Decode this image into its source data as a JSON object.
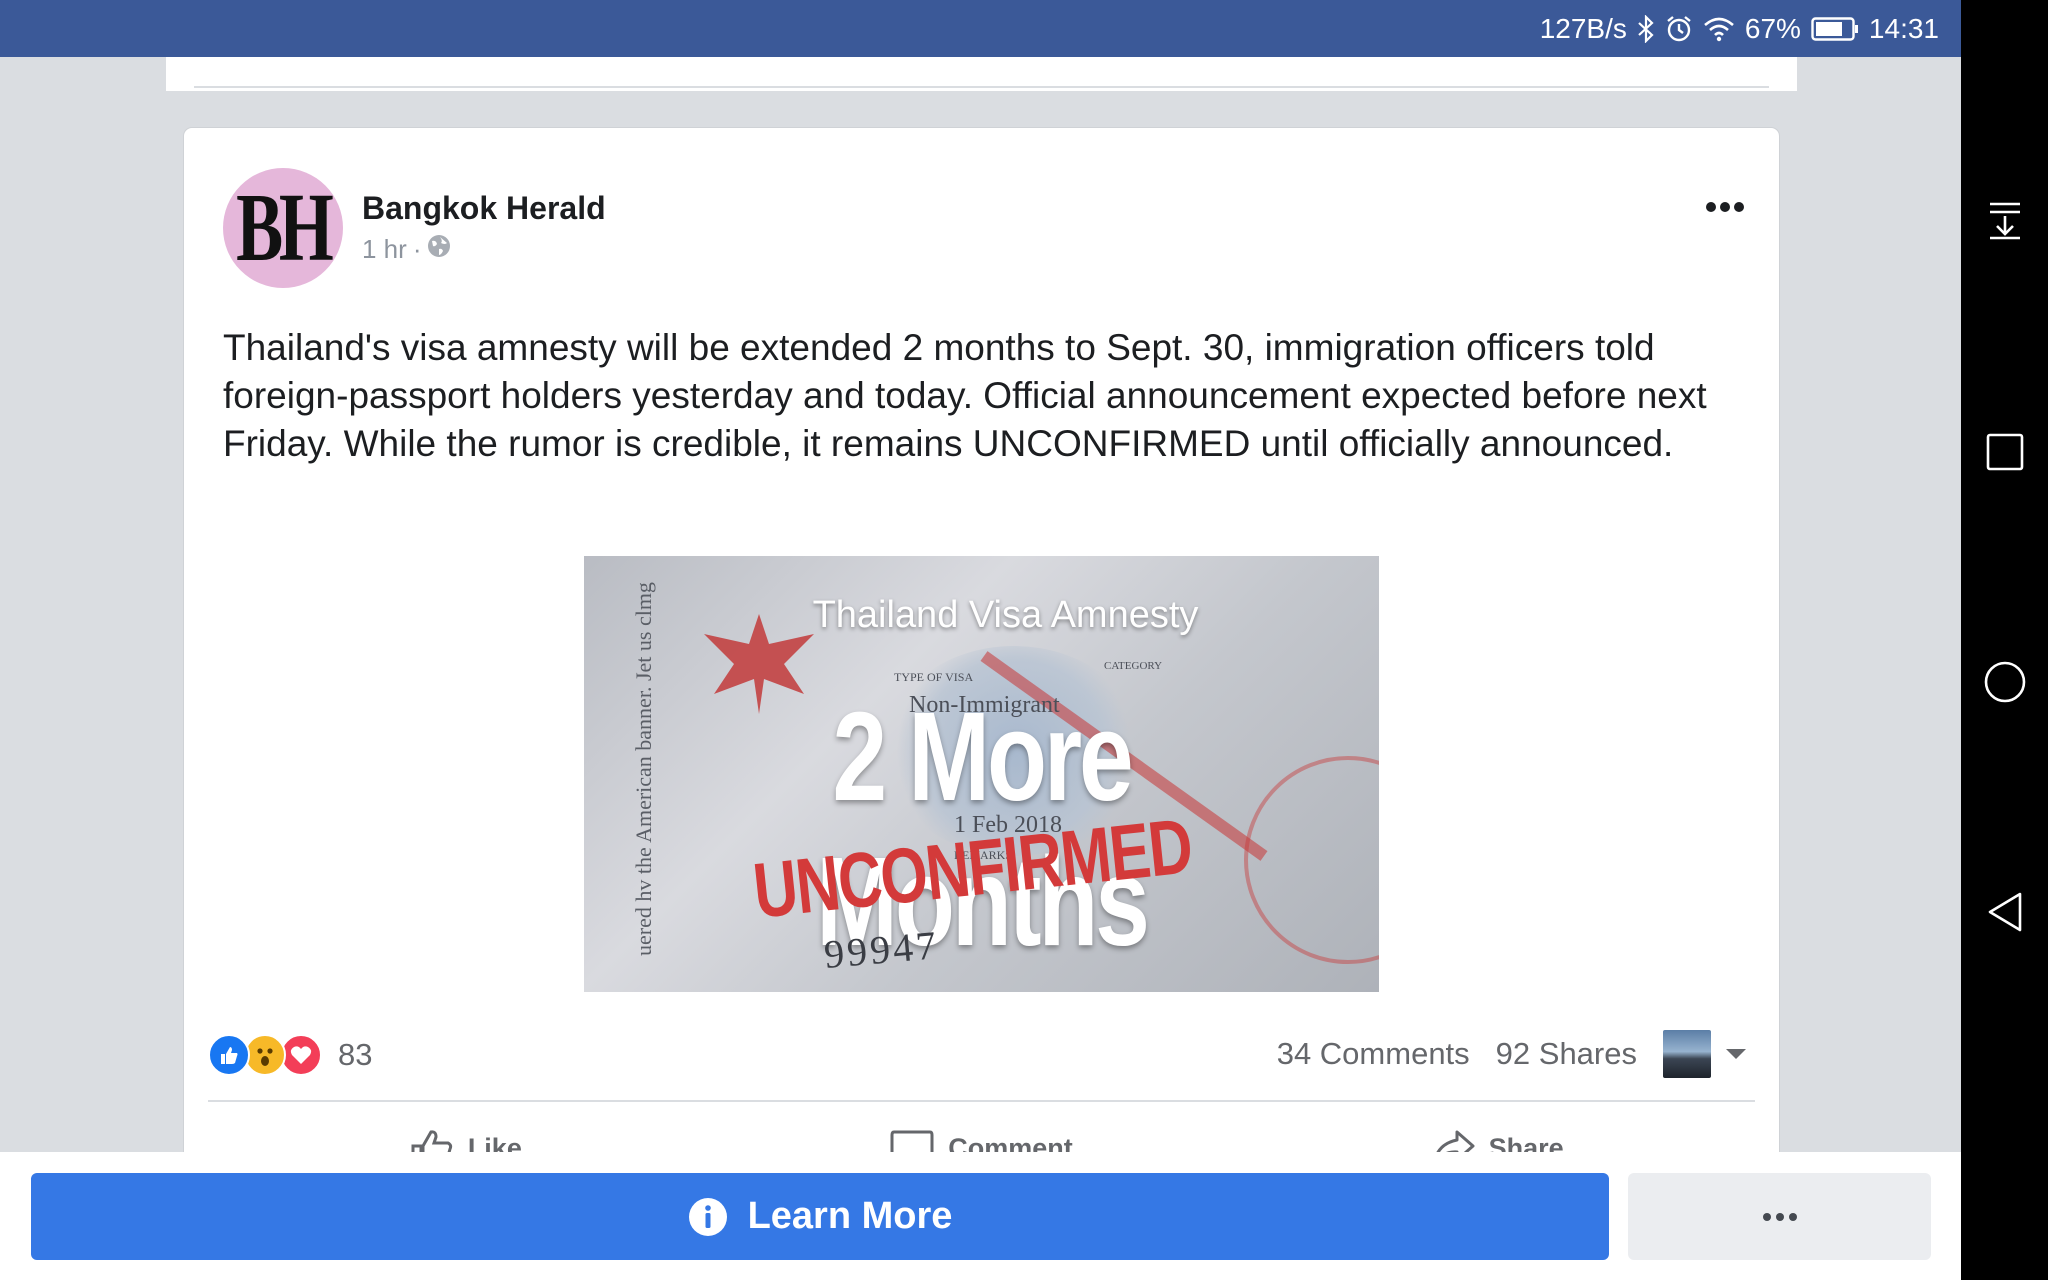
{
  "status_bar": {
    "network_speed": "127B/s",
    "icons": [
      "bluetooth-icon",
      "alarm-icon",
      "wifi-icon"
    ],
    "battery": "67%",
    "time": "14:31"
  },
  "post": {
    "page_name": "Bangkok Herald",
    "avatar_initials": "BH",
    "time": "1 hr",
    "separator": "·",
    "audience_icon": "globe-icon",
    "text": "Thailand's visa amnesty will be extended 2 months to Sept. 30, immigration officers told foreign-passport holders yesterday and today. Official announcement expected before next Friday. While the rumor is credible, it remains UNCONFIRMED until officially announced.",
    "image": {
      "caption": "Thailand Visa Amnesty",
      "headline": "2 More Months",
      "stamp": "UNCONFIRMED",
      "visa_type_label": "TYPE OF VISA",
      "visa_type_value": "Non-Immigrant",
      "category_label": "CATEGORY",
      "remarks_label": "REMARKS",
      "date_value": "1 Feb 2018",
      "side_text": "uered hv the American banner. Jet us clmg",
      "number_value": "99947"
    },
    "reactions": {
      "types": [
        "like",
        "wow",
        "love"
      ],
      "count": "83"
    },
    "comments": "34 Comments",
    "shares": "92 Shares",
    "actions": {
      "like": "Like",
      "comment": "Comment",
      "share": "Share"
    }
  },
  "cta": {
    "learn_more": "Learn More"
  },
  "colors": {
    "brand_blue": "#3b5998",
    "cta_blue": "#3578e5",
    "text_secondary": "#65676b",
    "stamp_red": "#d33a3a"
  }
}
